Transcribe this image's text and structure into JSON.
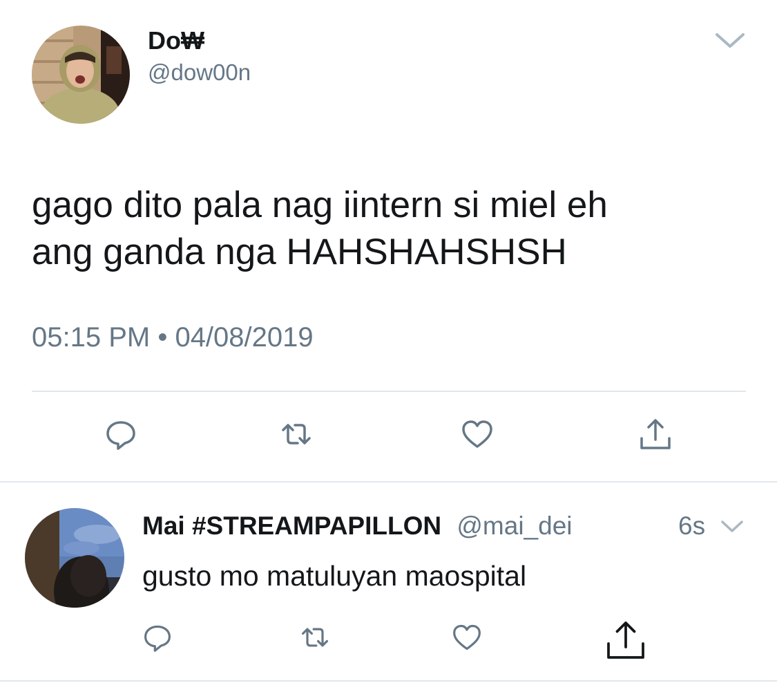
{
  "main_tweet": {
    "display_name": "Do₩",
    "handle": "@dow00n",
    "text_lines": [
      "gago dito pala nag iintern si miel eh",
      "ang ganda nga HAHSHAHSHSH"
    ],
    "timestamp": "05:15 PM • 04/08/2019",
    "actions": [
      "reply-icon",
      "retweet-icon",
      "like-icon",
      "share-icon"
    ],
    "menu_icon": "chevron-down-icon"
  },
  "reply_tweet": {
    "display_name": "Mai #STREAMPAPILLON",
    "handle": "@mai_dei",
    "time": "6s",
    "text": "gusto mo matuluyan maospital",
    "actions": [
      "reply-icon",
      "retweet-icon",
      "like-icon",
      "share-icon"
    ],
    "menu_icon": "chevron-down-icon"
  },
  "colors": {
    "text_primary": "#14171a",
    "text_secondary": "#657786",
    "icon": "#657786",
    "divider": "#e1e8ed"
  }
}
